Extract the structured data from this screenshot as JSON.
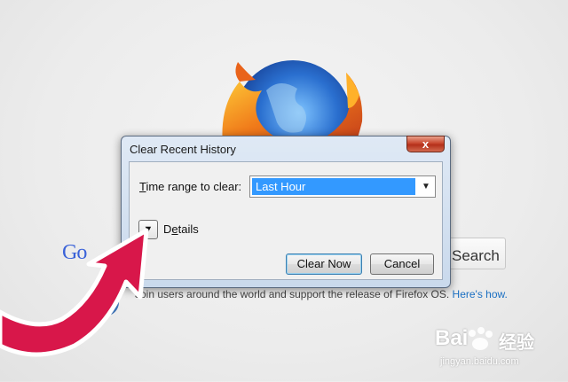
{
  "background_page": {
    "google_text": "Go",
    "search_button_label": "Search",
    "promo_text": "Join users around the world and support the release of Firefox OS.",
    "promo_link": "Here's how."
  },
  "dialog": {
    "title": "Clear Recent History",
    "close_glyph": "x",
    "time_range_label_prefix": "T",
    "time_range_label_rest": "ime range to clear:",
    "time_range_value": "Last Hour",
    "dropdown_glyph": "▼",
    "details_toggle_glyph": "▼",
    "details_label_prefix": "D",
    "details_label_mnemonic": "e",
    "details_label_rest": "tails",
    "clear_now_label": "Clear Now",
    "cancel_label": "Cancel"
  },
  "watermark": {
    "brand": "Bai",
    "brand_tail": "经验",
    "url": "jingyan.baidu.com"
  },
  "colors": {
    "accent_red": "#d8174a",
    "selection_blue": "#3399ff"
  },
  "icons": {
    "logo": "firefox-logo-icon",
    "arrow": "red-pointer-arrow-icon",
    "close": "close-icon",
    "dropdown": "chevron-down-icon"
  }
}
